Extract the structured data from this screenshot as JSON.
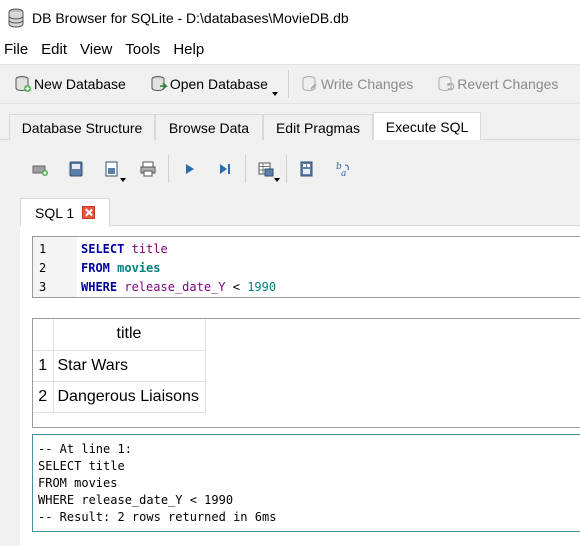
{
  "window": {
    "title": "DB Browser for SQLite - D:\\databases\\MovieDB.db"
  },
  "menu": [
    "File",
    "Edit",
    "View",
    "Tools",
    "Help"
  ],
  "toolbar": {
    "new_database": "New Database",
    "open_database": "Open Database",
    "write_changes": "Write Changes",
    "revert_changes": "Revert Changes"
  },
  "tabs": [
    "Database Structure",
    "Browse Data",
    "Edit Pragmas",
    "Execute SQL"
  ],
  "active_tab": "Execute SQL",
  "sql_tab": {
    "label": "SQL 1"
  },
  "editor": {
    "lines": [
      {
        "n": "1",
        "tokens": [
          {
            "t": "SELECT",
            "c": "kw"
          },
          {
            "t": " ",
            "c": "op"
          },
          {
            "t": "title",
            "c": "ident"
          }
        ]
      },
      {
        "n": "2",
        "tokens": [
          {
            "t": "FROM",
            "c": "kw"
          },
          {
            "t": " ",
            "c": "op"
          },
          {
            "t": "movies",
            "c": "tbl"
          }
        ]
      },
      {
        "n": "3",
        "tokens": [
          {
            "t": "WHERE",
            "c": "kw"
          },
          {
            "t": " ",
            "c": "op"
          },
          {
            "t": "release_date_Y",
            "c": "ident"
          },
          {
            "t": " < ",
            "c": "op"
          },
          {
            "t": "1990",
            "c": "num"
          }
        ]
      }
    ]
  },
  "results": {
    "column": "title",
    "rows": [
      {
        "n": "1",
        "value": "Star Wars"
      },
      {
        "n": "2",
        "value": "Dangerous Liaisons"
      }
    ]
  },
  "log": [
    "-- At line 1:",
    "SELECT title",
    "FROM movies",
    "WHERE release_date_Y < 1990",
    "-- Result: 2 rows returned in 6ms"
  ],
  "colors": {
    "keyword": "#0000a0",
    "identifier": "#7f007f",
    "table": "#008080",
    "close": "#e8543a"
  }
}
